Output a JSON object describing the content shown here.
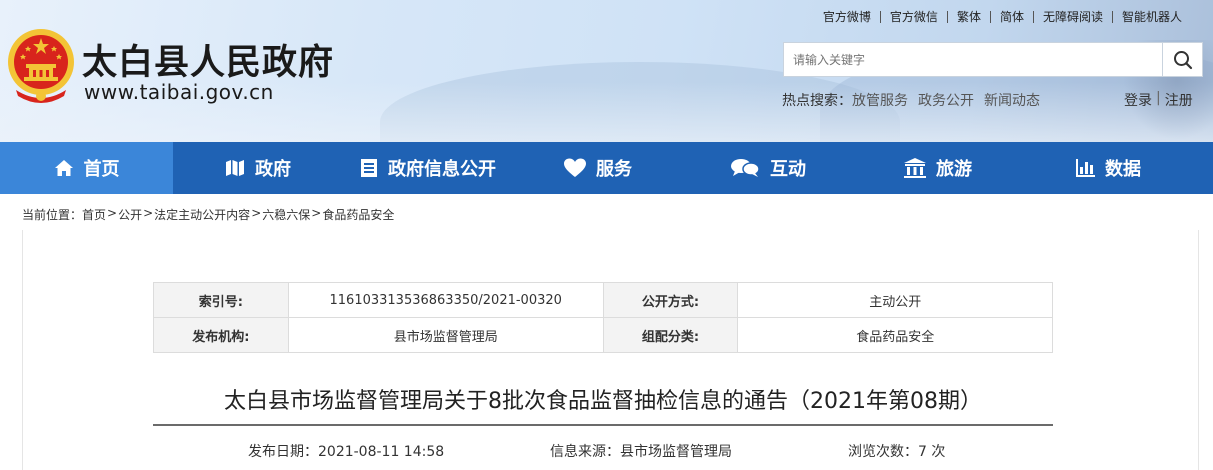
{
  "site": {
    "title": "太白县人民政府",
    "url": "www.taibai.gov.cn"
  },
  "top_links": [
    "官方微博",
    "官方微信",
    "繁体",
    "简体",
    "无障碍阅读",
    "智能机器人"
  ],
  "search": {
    "placeholder": "请输入关键字"
  },
  "hot_search": {
    "label": "热点搜索：",
    "keywords": [
      "放管服务",
      "政务公开",
      "新闻动态"
    ]
  },
  "auth": {
    "login": "登录",
    "separator": "|",
    "register": "注册"
  },
  "nav": [
    {
      "label": "首页",
      "icon": "home-icon",
      "active": true
    },
    {
      "label": "政府",
      "icon": "map-icon",
      "active": false
    },
    {
      "label": "政府信息公开",
      "icon": "list-icon",
      "active": false
    },
    {
      "label": "服务",
      "icon": "heart-icon",
      "active": false
    },
    {
      "label": "互动",
      "icon": "chat-icon",
      "active": false
    },
    {
      "label": "旅游",
      "icon": "building-icon",
      "active": false
    },
    {
      "label": "数据",
      "icon": "bar-chart-icon",
      "active": false
    }
  ],
  "breadcrumb": {
    "prefix": "当前位置：",
    "items": [
      "首页",
      "公开",
      "法定主动公开内容",
      "六稳六保",
      "食品药品安全"
    ]
  },
  "info": {
    "index_label": "索引号:",
    "index_value": "116103313536863350/2021-00320",
    "method_label": "公开方式:",
    "method_value": "主动公开",
    "publisher_label": "发布机构:",
    "publisher_value": "县市场监督管理局",
    "category_label": "组配分类:",
    "category_value": "食品药品安全"
  },
  "article": {
    "title": "太白县市场监督管理局关于8批次食品监督抽检信息的通告（2021年第08期）",
    "date_label": "发布日期：",
    "date_value": "2021-08-11 14:58",
    "source_label": "信息来源：",
    "source_value": "县市场监督管理局",
    "views_label": "浏览次数：",
    "views_value": "7 次"
  },
  "colors": {
    "nav_bg": "#1f62b4",
    "nav_active": "#3b86d9",
    "emblem_red": "#d8241c",
    "emblem_gold": "#f3c436"
  }
}
